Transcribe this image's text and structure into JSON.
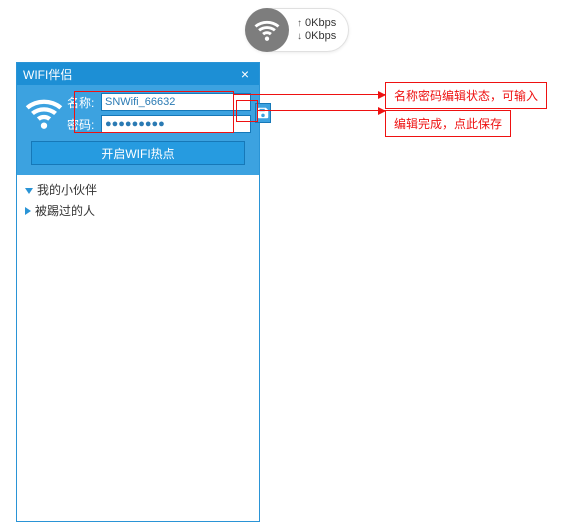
{
  "speed": {
    "up": "0Kbps",
    "down": "0Kbps"
  },
  "window": {
    "title": "WIFI伴侣",
    "name_label": "名称:",
    "pwd_label": "密码:",
    "name_value": "SNWifi_66632",
    "pwd_value": "●●●●●●●●●",
    "start_label": "开启WIFI热点"
  },
  "tree": {
    "items": [
      {
        "label": "我的小伙伴",
        "expanded": true
      },
      {
        "label": "被踢过的人",
        "expanded": false
      }
    ]
  },
  "annotations": {
    "a1": "名称密码编辑状态，可输入",
    "a2": "编辑完成，点此保存"
  }
}
